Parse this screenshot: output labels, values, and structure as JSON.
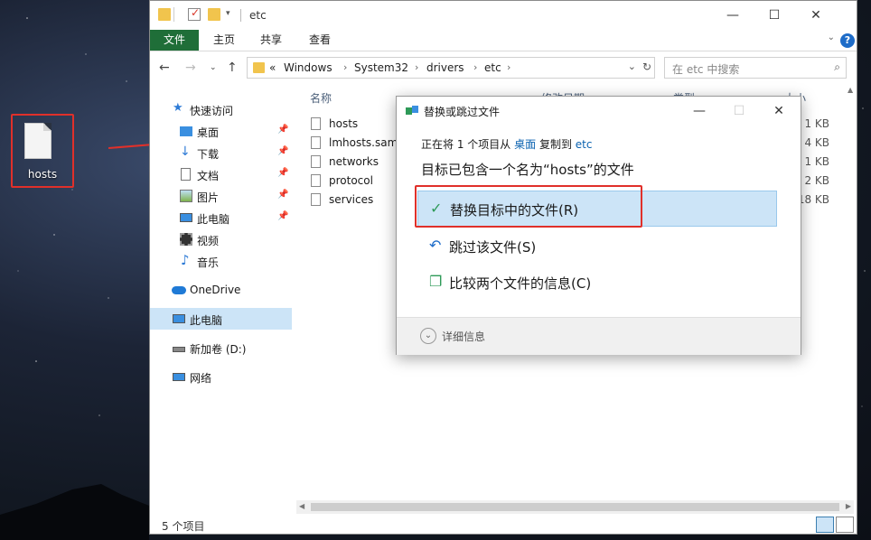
{
  "desktop": {
    "icon_label": "hosts"
  },
  "window": {
    "title": "etc",
    "ribbon_tabs": [
      "文件",
      "主页",
      "共享",
      "查看"
    ],
    "help": "?",
    "breadcrumb": {
      "prefix": "«",
      "items": [
        "Windows",
        "System32",
        "drivers",
        "etc"
      ]
    },
    "search_placeholder": "在 etc 中搜索",
    "sidebar": [
      {
        "label": "快速访问",
        "icon": "star-icon"
      },
      {
        "label": "桌面",
        "icon": "desktop-icon"
      },
      {
        "label": "下载",
        "icon": "download-icon"
      },
      {
        "label": "文档",
        "icon": "document-icon"
      },
      {
        "label": "图片",
        "icon": "picture-icon"
      },
      {
        "label": "此电脑",
        "icon": "computer-icon"
      },
      {
        "label": "视频",
        "icon": "video-icon"
      },
      {
        "label": "音乐",
        "icon": "music-icon"
      },
      {
        "label": "OneDrive",
        "icon": "cloud-icon"
      },
      {
        "label": "此电脑",
        "icon": "computer-icon"
      },
      {
        "label": "新加卷 (D:)",
        "icon": "drive-icon"
      },
      {
        "label": "网络",
        "icon": "network-icon"
      }
    ],
    "columns": {
      "name": "名称",
      "modified": "修改日期",
      "type": "类型",
      "size": "大小"
    },
    "files": [
      {
        "name": "hosts",
        "size": "1 KB"
      },
      {
        "name": "lmhosts.sam",
        "size": "4 KB"
      },
      {
        "name": "networks",
        "size": "1 KB"
      },
      {
        "name": "protocol",
        "size": "2 KB"
      },
      {
        "name": "services",
        "size": "18 KB"
      }
    ],
    "status": "5 个项目"
  },
  "dialog": {
    "title": "替换或跳过文件",
    "line1": {
      "a": "正在将 1 个项目从",
      "src": "桌面",
      "b": "复制到",
      "dst": "etc"
    },
    "heading": "目标已包含一个名为“hosts”的文件",
    "options": [
      {
        "label": "替换目标中的文件(R)",
        "icon": "check-icon"
      },
      {
        "label": "跳过该文件(S)",
        "icon": "skip-icon"
      },
      {
        "label": "比较两个文件的信息(C)",
        "icon": "compare-icon"
      }
    ],
    "details": "详细信息"
  },
  "colors": {
    "accent": "#1f6e38",
    "selection": "#cce4f7",
    "highlight_box": "#e0302a",
    "link": "#0a62b0"
  }
}
